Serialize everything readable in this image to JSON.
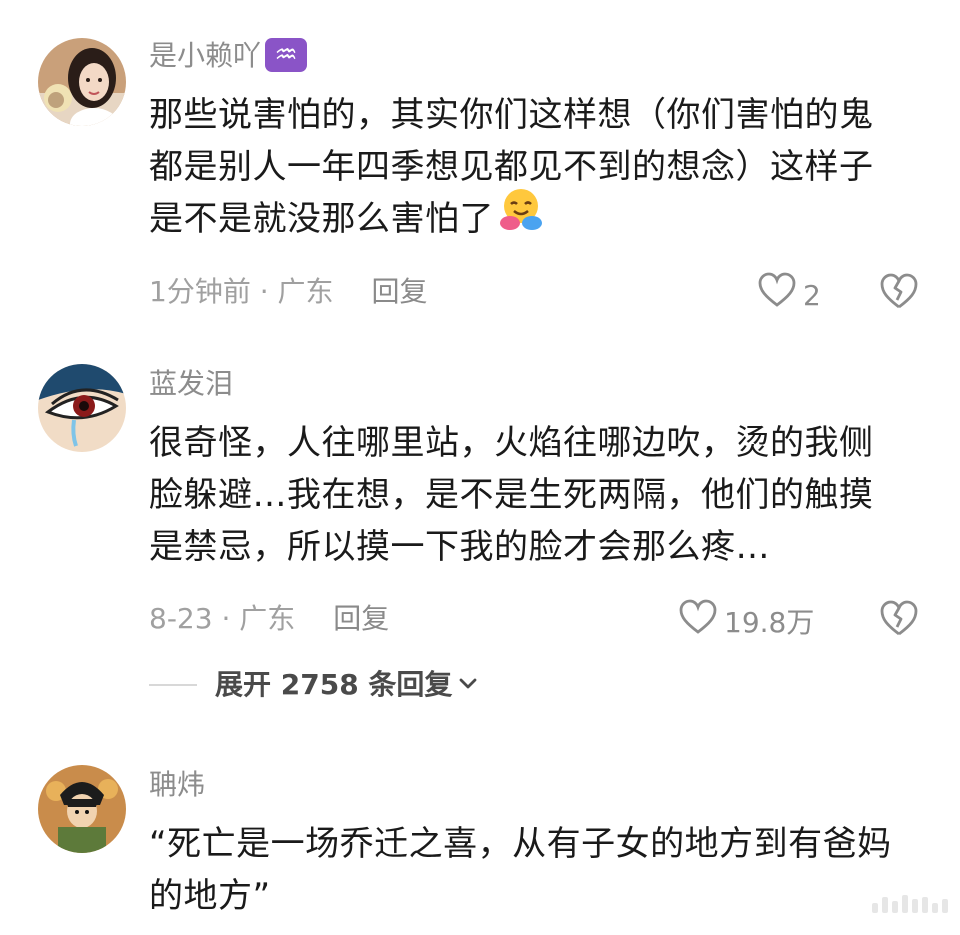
{
  "comments": [
    {
      "username": "是小赖吖",
      "badge": "♒",
      "lines": [
        "那些说害怕的，其实你们这样想（你们害怕的鬼",
        "都是别人一年四季想见都见不到的想念）这样子",
        "是不是就没那么害怕了"
      ],
      "emoji": "hugging-face-emoji",
      "time_location": "1分钟前 · 广东",
      "reply_label": "回复",
      "like_count": "2"
    },
    {
      "username": "蓝发泪",
      "lines": [
        "很奇怪，人往哪里站，火焰往哪边吹，烫的我侧",
        "脸躲避…我在想，是不是生死两隔，他们的触摸",
        "是禁忌，所以摸一下我的脸才会那么疼…"
      ],
      "time_location": "8-23 · 广东",
      "reply_label": "回复",
      "like_count": "19.8万",
      "expand_label": "展开 2758 条回复"
    },
    {
      "username": "聃炜",
      "lines": [
        "“死亡是一场乔迁之喜，从有子女的地方到有爸妈",
        "的地方”"
      ]
    }
  ],
  "icons": {
    "heart": "heart-outline-icon",
    "dislike": "broken-heart-icon",
    "expand": "chevron-down-icon"
  },
  "colors": {
    "username": "#8c8c8c",
    "meta": "#a0a0a0",
    "zodiac_badge": "#8a54c7"
  }
}
